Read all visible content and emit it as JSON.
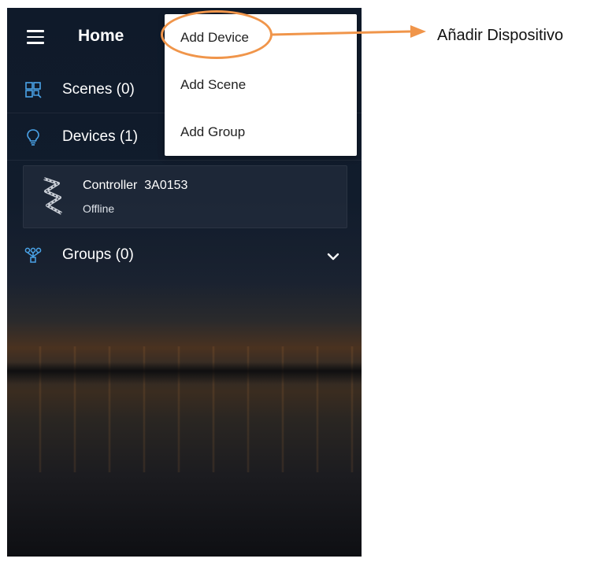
{
  "header": {
    "title": "Home",
    "menu_icon": "hamburger-menu-icon"
  },
  "sections": {
    "scenes": {
      "label": "Scenes (0)",
      "icon": "scenes-icon"
    },
    "devices": {
      "label": "Devices (1)",
      "icon": "lightbulb-icon"
    },
    "groups": {
      "label": "Groups (0)",
      "icon": "groups-icon",
      "expand_icon": "chevron-down-icon"
    }
  },
  "device": {
    "name": "Controller  3A0153",
    "status": "Offline",
    "icon": "led-strip-icon"
  },
  "dropdown_menu": {
    "items": [
      {
        "label": "Add Device"
      },
      {
        "label": "Add Scene"
      },
      {
        "label": "Add Group"
      }
    ]
  },
  "annotation": {
    "text": "Añadir Dispositivo",
    "color": "#f0954a"
  },
  "colors": {
    "accent_icon": "#4aa3e8",
    "header_text": "#ffffff"
  }
}
